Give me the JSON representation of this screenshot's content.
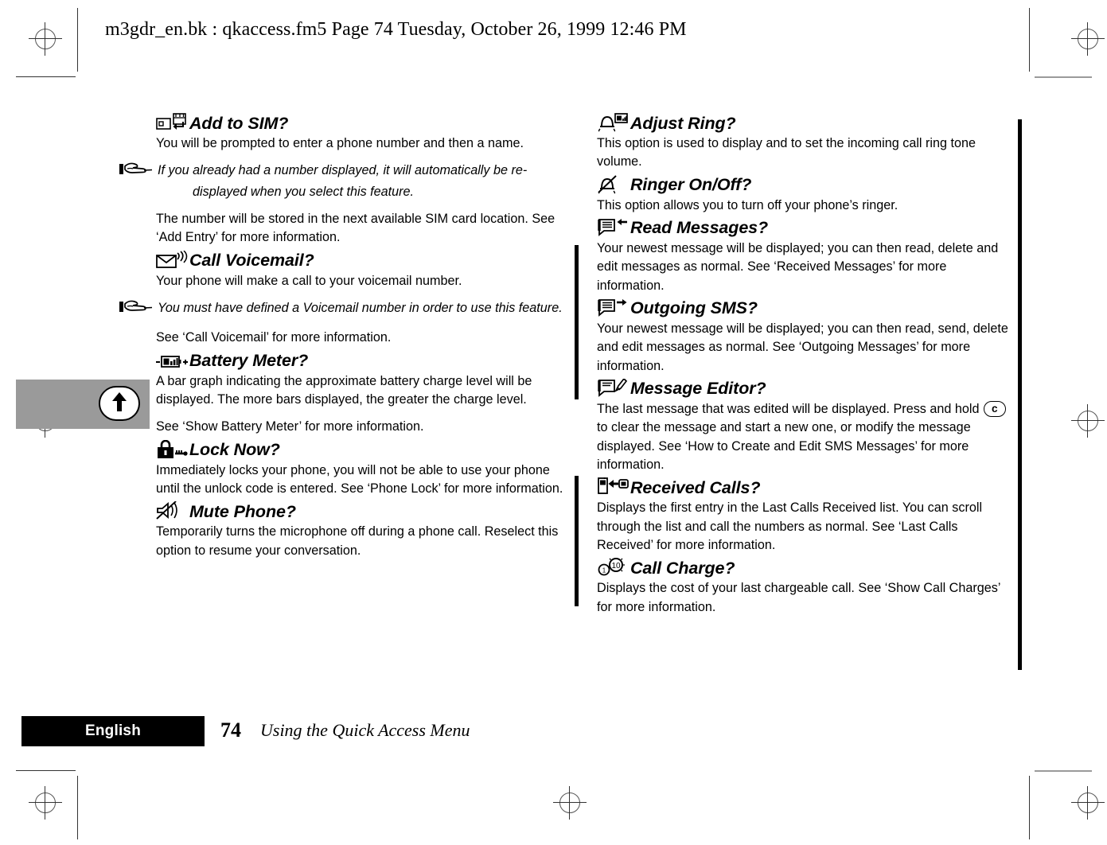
{
  "header": {
    "text": "m3gdr_en.bk : qkaccess.fm5  Page 74  Tuesday, October 26, 1999  12:46 PM"
  },
  "margin_tab": {
    "icon": "up-arrow-icon"
  },
  "columns": {
    "left": [
      {
        "icon": "add-to-sim-icon",
        "title": "Add to SIM?",
        "blocks": [
          {
            "kind": "text",
            "text": "You will be prompted to enter a phone number and then a name."
          },
          {
            "kind": "note",
            "text": "If you already had a number displayed, it will automatically be re-displayed when you select this feature."
          },
          {
            "kind": "text",
            "text": "The number will be stored in the next available SIM card location. See ‘Add Entry’ for more information."
          }
        ]
      },
      {
        "icon": "voicemail-envelope-icon",
        "title": "Call Voicemail?",
        "blocks": [
          {
            "kind": "text",
            "text": "Your phone will make a call to your voicemail number."
          },
          {
            "kind": "note",
            "text": "You must have defined a Voicemail number in order to use this feature."
          },
          {
            "kind": "text",
            "text": "See ‘Call Voicemail’ for more information."
          }
        ]
      },
      {
        "icon": "battery-meter-icon",
        "title": "Battery Meter?",
        "blocks": [
          {
            "kind": "text",
            "text": "A bar graph indicating the approximate battery charge level will be displayed. The more bars displayed, the greater the charge level."
          },
          {
            "kind": "text",
            "text": "See ‘Show Battery Meter’ for more information."
          }
        ]
      },
      {
        "icon": "padlock-key-icon",
        "title": "Lock Now?",
        "blocks": [
          {
            "kind": "text",
            "text": "Immediately locks your phone, you will not be able to use your phone until the unlock code is entered. See ‘Phone Lock’ for more information."
          }
        ]
      },
      {
        "icon": "mute-speaker-icon",
        "title": "Mute Phone?",
        "blocks": [
          {
            "kind": "text",
            "text": "Temporarily turns the microphone off during a phone call. Reselect this option to resume your conversation."
          }
        ]
      }
    ],
    "right": [
      {
        "icon": "bell-level-icon",
        "title": "Adjust Ring?",
        "blocks": [
          {
            "kind": "text",
            "text": "This option is used to display and to set the incoming call ring tone volume."
          }
        ]
      },
      {
        "icon": "bell-crossed-icon",
        "title": "Ringer On/Off?",
        "blocks": [
          {
            "kind": "text",
            "text": "This option allows you to turn off your phone’s ringer."
          }
        ]
      },
      {
        "icon": "message-in-icon",
        "title": "Read Messages?",
        "blocks": [
          {
            "kind": "text",
            "text": "Your newest message will be displayed; you can then read, delete and edit messages as normal. See ‘Received Messages’ for more information."
          }
        ]
      },
      {
        "icon": "message-out-icon",
        "title": "Outgoing SMS?",
        "blocks": [
          {
            "kind": "text",
            "text": "Your newest message will be displayed; you can then read, send, delete and edit messages as normal. See ‘Outgoing Messages’ for more information."
          }
        ]
      },
      {
        "icon": "message-edit-icon",
        "title": "Message Editor?",
        "blocks": [
          {
            "kind": "keytext",
            "before": "The last message that was edited will be displayed. Press and hold",
            "key": "c",
            "after": "to clear the message and start a new one, or modify the message displayed. See ‘How to Create and Edit SMS Messages’ for more information."
          }
        ]
      },
      {
        "icon": "received-calls-icon",
        "title": "Received Calls?",
        "blocks": [
          {
            "kind": "text",
            "text": "Displays the first entry in the Last Calls Received list. You can scroll through the list and call the numbers as normal. See ‘Last Calls Received’ for more information."
          }
        ]
      },
      {
        "icon": "call-charge-coins-icon",
        "title": "Call Charge?",
        "blocks": [
          {
            "kind": "text",
            "text": "Displays the cost of your last chargeable call. See ‘Show Call Charges’ for more information."
          }
        ]
      }
    ]
  },
  "footer": {
    "language": "English",
    "page_number": "74",
    "section_title": "Using the Quick Access Menu"
  },
  "colors": {
    "ink": "#000000",
    "page": "#ffffff",
    "tab_gray": "#9a9a9a",
    "mark_gray": "#555555"
  }
}
